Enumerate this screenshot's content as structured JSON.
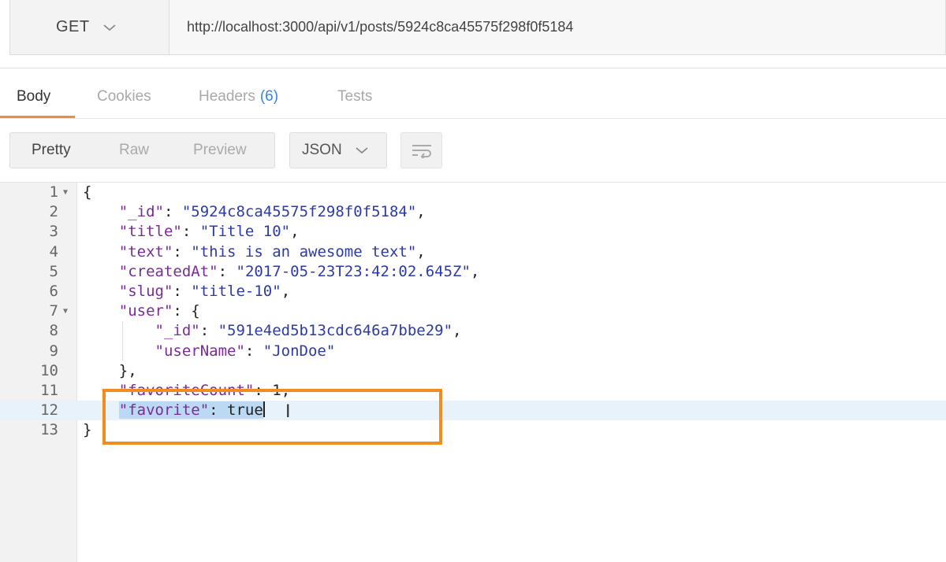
{
  "request": {
    "method": "GET",
    "url": "http://localhost:3000/api/v1/posts/5924c8ca45575f298f0f5184"
  },
  "response_tabs": [
    {
      "label": "Body",
      "badge": ""
    },
    {
      "label": "Cookies",
      "badge": ""
    },
    {
      "label": "Headers",
      "badge": "(6)"
    },
    {
      "label": "Tests",
      "badge": ""
    }
  ],
  "view_modes": [
    "Pretty",
    "Raw",
    "Preview"
  ],
  "format": "JSON",
  "icons": {
    "method_dropdown": "chevron-down-icon",
    "format_dropdown": "chevron-down-icon",
    "wrap": "wrap-lines-icon",
    "fold": "fold-arrow-icon",
    "cursor": "text-cursor-icon"
  },
  "colors": {
    "active_tab_underline": "#f08a3c",
    "annotation_box": "#f28c1e",
    "json_key": "#7a2b9a",
    "json_string": "#2d3aa8",
    "selected_line": "#e8f2fb",
    "badge": "#3a86d6"
  },
  "code": {
    "line_numbers": [
      "1",
      "2",
      "3",
      "4",
      "5",
      "6",
      "7",
      "8",
      "9",
      "10",
      "11",
      "12",
      "13"
    ],
    "open_brace": "{",
    "close_brace": "}",
    "id_key": "\"_id\"",
    "id_value": "\"5924c8ca45575f298f0f5184\"",
    "title_key": "\"title\"",
    "title_value": "\"Title 10\"",
    "text_key": "\"text\"",
    "text_value": "\"this is an awesome text\"",
    "created_key": "\"createdAt\"",
    "created_value": "\"2017-05-23T23:42:02.645Z\"",
    "slug_key": "\"slug\"",
    "slug_value": "\"title-10\"",
    "user_key": "\"user\"",
    "user_id_key": "\"_id\"",
    "user_id_value": "\"591e4ed5b13cdc646a7bbe29\"",
    "username_key": "\"userName\"",
    "username_value": "\"JonDoe\"",
    "user_close": "},",
    "favcount_key": "\"favoriteCount\"",
    "favcount_value": "1",
    "favorite_key": "\"favorite\"",
    "favorite_value": "true"
  }
}
